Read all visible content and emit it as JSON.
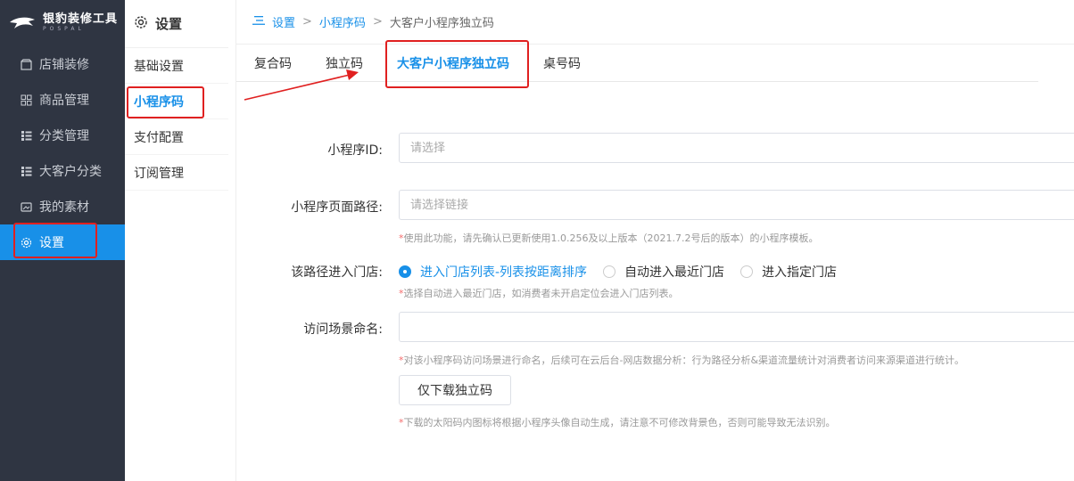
{
  "logo": {
    "title": "银豹装修工具",
    "subtitle": "POSPAL"
  },
  "sidebar": {
    "items": [
      {
        "label": "店铺装修",
        "icon": "store-icon"
      },
      {
        "label": "商品管理",
        "icon": "grid-icon"
      },
      {
        "label": "分类管理",
        "icon": "list-icon"
      },
      {
        "label": "大客户分类",
        "icon": "list-icon"
      },
      {
        "label": "我的素材",
        "icon": "image-icon"
      },
      {
        "label": "设置",
        "icon": "gear-icon",
        "active": true
      }
    ]
  },
  "subnav": {
    "header": "设置",
    "items": [
      {
        "label": "基础设置"
      },
      {
        "label": "小程序码",
        "active": true
      },
      {
        "label": "支付配置"
      },
      {
        "label": "订阅管理"
      }
    ]
  },
  "breadcrumb": {
    "items": [
      "设置",
      "小程序码",
      "大客户小程序独立码"
    ]
  },
  "tabs": [
    "复合码",
    "独立码",
    "大客户小程序独立码",
    "桌号码"
  ],
  "form": {
    "miniprogram_id": {
      "label": "小程序ID:",
      "placeholder": "请选择"
    },
    "page_path": {
      "label": "小程序页面路径:",
      "placeholder": "请选择链接",
      "hint": "使用此功能，请先确认已更新使用1.0.256及以上版本（2021.7.2号后的版本）的小程序模板。"
    },
    "store_entry": {
      "label": "该路径进入门店:",
      "options": [
        "进入门店列表-列表按距离排序",
        "自动进入最近门店",
        "进入指定门店"
      ],
      "selected": "进入门店列表-列表按距离排序",
      "hint": "选择自动进入最近门店，如消费者未开启定位会进入门店列表。"
    },
    "scene_name": {
      "label": "访问场景命名:",
      "value": "",
      "hint": "对该小程序码访问场景进行命名，后续可在云后台-网店数据分析：行为路径分析&渠道流量统计对消费者访问来源渠道进行统计。"
    },
    "download_button": "仅下载独立码",
    "download_hint": "下载的太阳码内图标将根据小程序头像自动生成，请注意不可修改背景色，否则可能导致无法识别。"
  },
  "colors": {
    "accent": "#1890e8",
    "sidebar_bg": "#2f3542",
    "annotation": "#e02020"
  }
}
